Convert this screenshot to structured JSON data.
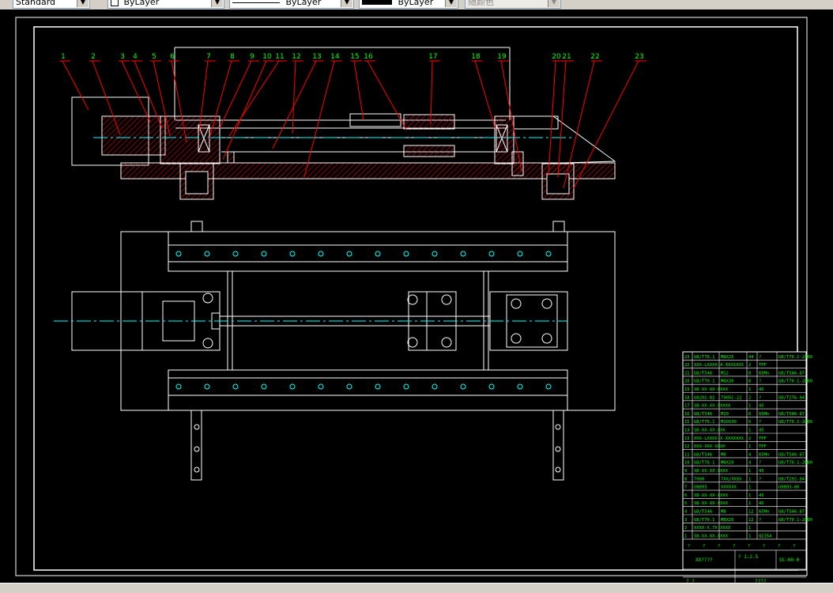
{
  "toolbar": {
    "text_style": "Standard",
    "layer_color": "ByLayer",
    "linetype": "ByLayer",
    "lineweight": "ByLayer",
    "plot_style": "随颜色"
  },
  "colors": {
    "background": "#000000",
    "outline": "#ffffff",
    "hatch": "#ff0000",
    "leader": "#ff0000",
    "callout_text": "#00ff00",
    "centerline": "#00ffff",
    "frame": "#00ff00"
  },
  "callouts": [
    "1",
    "2",
    "3",
    "4",
    "5",
    "6",
    "7",
    "8",
    "9",
    "10",
    "11",
    "12",
    "13",
    "14",
    "15",
    "16",
    "17",
    "18",
    "19",
    "20",
    "21",
    "22",
    "23"
  ],
  "parts_list": [
    [
      "23",
      "GB/T70.1",
      "M8X25",
      "44",
      "?",
      "GB/T70.1-2000"
    ],
    [
      "22",
      "XXX-LXXXX-A-XXXXXXX",
      "",
      "2",
      "TPF",
      ""
    ],
    [
      "21",
      "GB/T546",
      "M12",
      "8",
      "65Mn",
      "GB/T546-87"
    ],
    [
      "20",
      "GB/T70.1",
      "M8X30",
      "8",
      "?",
      "GB/T70.1-2000"
    ],
    [
      "19",
      "SB-XX-XX-XXXX",
      "",
      "1",
      "45",
      ""
    ],
    [
      "18",
      "GB292-82",
      "7905C-22",
      "2",
      "?",
      "GB/T276-94"
    ],
    [
      "17",
      "SB-XX-XX-XXXXX",
      "",
      "1",
      "45",
      ""
    ],
    [
      "16",
      "GB/T546",
      "M10",
      "6",
      "65Mn",
      "GB/T546-87"
    ],
    [
      "15",
      "GB/T70.1",
      "M10X30",
      "6",
      "?",
      "GB/T70.1-2000"
    ],
    [
      "14",
      "SB-XX-XX-XXX",
      "",
      "1",
      "45",
      ""
    ],
    [
      "13",
      "XXX-LXXXX-X-XXXXXXX",
      "",
      "2",
      "TPF",
      ""
    ],
    [
      "12",
      "XXX-XXX-XXXX",
      "",
      "1",
      "TPF",
      ""
    ],
    [
      "11",
      "GB/T546",
      "M8",
      "4",
      "65Mn",
      "GB/T546-87"
    ],
    [
      "10",
      "GB/T70.1",
      "M8X20",
      "4",
      "?",
      "GB/T70.1-2000"
    ],
    [
      "9",
      "SB-XX-XX-XXXX",
      "",
      "1",
      "45",
      ""
    ],
    [
      "8",
      "7000",
      "7XX/XXXX",
      "1",
      "?",
      "GB/T292-94"
    ],
    [
      "7",
      "GB893",
      "XXXXXX",
      "1",
      "",
      "GB893-86"
    ],
    [
      "6",
      "SB-XX-XX-XXXX",
      "",
      "1",
      "45",
      ""
    ],
    [
      "5",
      "SB-XX-XX-XXXX",
      "",
      "1",
      "45",
      ""
    ],
    [
      "4",
      "GB/T546",
      "M8",
      "12",
      "65Mn",
      "GB/T546-87"
    ],
    [
      "3",
      "GB/T70.1",
      "M8X20",
      "12",
      "?",
      "GB/T70.1-2000"
    ],
    [
      "2",
      "XXXX-X.7X-XXXX",
      "",
      "1",
      "",
      ""
    ],
    [
      "1",
      "SB-XX-XX-XXXX",
      "",
      "1",
      "Q235A",
      ""
    ]
  ],
  "title_block": {
    "row_top": [
      "?",
      "?",
      "?",
      "?",
      "?",
      "?",
      "?",
      "?"
    ],
    "name": "XX????",
    "scale": "?  1:2.5",
    "drawing_no": "SC-00-0",
    "footer_left": "?  ?",
    "footer_right": "????"
  }
}
